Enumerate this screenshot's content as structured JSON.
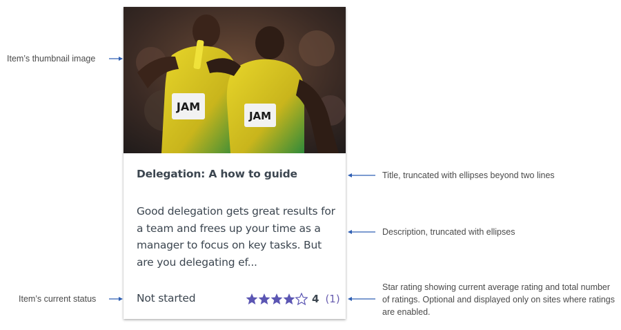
{
  "card": {
    "thumbnail_alt": "Relay runners in Jamaica uniforms",
    "bib_text": "JAM",
    "title": "Delegation: A how to guide",
    "description": "Good delegation gets great results for a team and frees up your time as a manager to focus on key tasks. But are you delegating ef...",
    "status": "Not started",
    "rating": {
      "average": "4",
      "count": "(1)",
      "stars_filled": 4,
      "stars_total": 5
    }
  },
  "annotations": {
    "thumbnail": "Item’s thumbnail image",
    "title": "Title, truncated with ellipses beyond two lines",
    "description": "Description, truncated with ellipses",
    "status": "Item’s current status",
    "rating": "Star rating showing current average rating and total number of ratings. Optional and displayed only on sites where ratings are enabled."
  },
  "colors": {
    "star": "#5b56b3",
    "annotation_arrow": "#2f5fb3",
    "text": "#3c4650"
  }
}
